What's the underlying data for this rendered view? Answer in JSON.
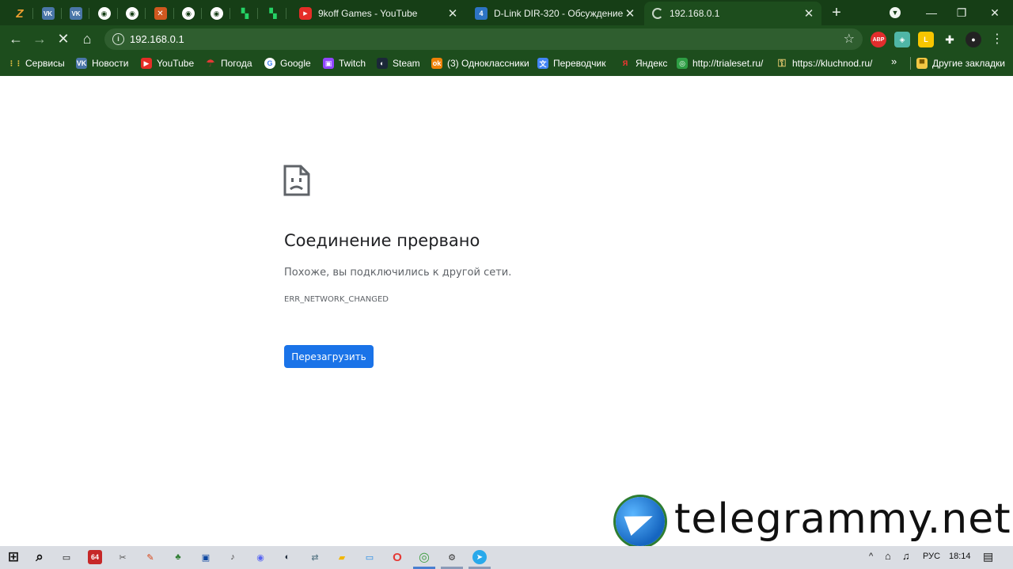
{
  "tabs": {
    "pinned": [
      {
        "icon": "z-icon",
        "glyph": "Z",
        "kind": "zz"
      },
      {
        "icon": "vk-icon",
        "glyph": "VK",
        "kind": "vk"
      },
      {
        "icon": "vk-icon",
        "glyph": "VK",
        "kind": "vk"
      },
      {
        "icon": "globe-icon",
        "glyph": "◉",
        "kind": "globe"
      },
      {
        "icon": "globe-icon",
        "glyph": "◉",
        "kind": "globe"
      },
      {
        "icon": "dota-icon",
        "glyph": "✕",
        "kind": "dota"
      },
      {
        "icon": "globe-icon",
        "glyph": "◉",
        "kind": "globe"
      },
      {
        "icon": "globe-icon",
        "glyph": "◉",
        "kind": "globe"
      },
      {
        "icon": "grid-icon",
        "glyph": "▚",
        "kind": "grid"
      },
      {
        "icon": "grid-icon",
        "glyph": "▚",
        "kind": "grid"
      }
    ],
    "items": [
      {
        "title": "9koff Games - YouTube",
        "icon": "youtube-icon"
      },
      {
        "title": "D-Link DIR-320 - Обсуждение -",
        "icon": "dlink-icon"
      },
      {
        "title": "192.168.0.1",
        "icon": "loading-spinner-icon"
      }
    ],
    "new_tab": "+"
  },
  "omnibox": {
    "url": "192.168.0.1"
  },
  "extensions": [
    {
      "name": "adblock-icon",
      "glyph": "ABP",
      "color": "#e22d2d"
    },
    {
      "name": "map-extension-icon",
      "glyph": "◈",
      "color": "#4fb6a6"
    },
    {
      "name": "tampermonkey-icon",
      "glyph": "L",
      "color": "#f7c600"
    },
    {
      "name": "puzzle-icon",
      "glyph": "✚",
      "color": "#1d4d1d"
    },
    {
      "name": "profile-avatar-icon",
      "glyph": "●",
      "color": "#222222"
    }
  ],
  "bookmarks": [
    {
      "label": "Сервисы",
      "icon": "apps-grid-icon",
      "glyph": "⋮⋮",
      "color": "#1d4d1d"
    },
    {
      "label": "Новости",
      "icon": "vk-icon",
      "glyph": "VK",
      "color": "#4a76a8"
    },
    {
      "label": "YouTube",
      "icon": "youtube-icon",
      "glyph": "▶",
      "color": "#e52d27"
    },
    {
      "label": "Погода",
      "icon": "umbrella-icon",
      "glyph": "☂",
      "color": "#1d4d1d"
    },
    {
      "label": "Google",
      "icon": "google-icon",
      "glyph": "G",
      "color": "#ffffff"
    },
    {
      "label": "Twitch",
      "icon": "twitch-icon",
      "glyph": "▣",
      "color": "#9146ff"
    },
    {
      "label": "Steam",
      "icon": "steam-icon",
      "glyph": "◐",
      "color": "#1b2838"
    },
    {
      "label": "(3) Одноклассники",
      "icon": "ok-icon",
      "glyph": "ok",
      "color": "#ee8208"
    },
    {
      "label": "Переводчик",
      "icon": "translate-icon",
      "glyph": "文",
      "color": "#4285f4"
    },
    {
      "label": "Яндекс",
      "icon": "yandex-icon",
      "glyph": "Я",
      "color": "#1d4d1d"
    },
    {
      "label": "http://trialeset.ru/",
      "icon": "globe-green-icon",
      "glyph": "◎",
      "color": "#2e9e44"
    },
    {
      "label": "https://kluchnod.ru/",
      "icon": "key-icon",
      "glyph": "⚿",
      "color": "#1d4d1d"
    }
  ],
  "bookmarks_more": "»",
  "other_bookmarks": "Другие закладки",
  "error": {
    "title": "Соединение прервано",
    "description": "Похоже, вы подключились к другой сети.",
    "code": "ERR_NETWORK_CHANGED",
    "reload_button": "Перезагрузить"
  },
  "watermark": {
    "text": "telegrammy.net"
  },
  "taskbar": {
    "apps": [
      {
        "name": "start-windows-icon",
        "glyph": "⊞",
        "color": "#111111"
      },
      {
        "name": "search-icon",
        "glyph": "⌕",
        "color": "#111111"
      },
      {
        "name": "task-view-icon",
        "glyph": "▭",
        "color": "#111111"
      },
      {
        "name": "aida64-icon",
        "glyph": "64",
        "color": "#c62828"
      },
      {
        "name": "snipping-tool-icon",
        "glyph": "✂",
        "color": "#555555"
      },
      {
        "name": "paint-icon",
        "glyph": "✎",
        "color": "#d84315"
      },
      {
        "name": "app-icon",
        "glyph": "♣",
        "color": "#2e7d32"
      },
      {
        "name": "terminal-icon",
        "glyph": "▣",
        "color": "#0d47a1"
      },
      {
        "name": "volume-mixer-icon",
        "glyph": "♪",
        "color": "#444444"
      },
      {
        "name": "discord-icon",
        "glyph": "◉",
        "color": "#5865f2"
      },
      {
        "name": "steam-icon",
        "glyph": "◐",
        "color": "#1b2838"
      },
      {
        "name": "network-tool-icon",
        "glyph": "⇄",
        "color": "#607d8b"
      },
      {
        "name": "file-explorer-icon",
        "glyph": "▰",
        "color": "#f2b705"
      },
      {
        "name": "monitor-icon",
        "glyph": "▭",
        "color": "#1e88e5"
      },
      {
        "name": "opera-icon",
        "glyph": "O",
        "color": "#e53935"
      },
      {
        "name": "chrome-icon",
        "glyph": "◎",
        "color": "#43a047"
      },
      {
        "name": "settings-gear-icon",
        "glyph": "⚙",
        "color": "#333333"
      },
      {
        "name": "telegram-icon",
        "glyph": "➤",
        "color": "#29a9eb"
      }
    ],
    "tray": {
      "chevron": "^",
      "network": "⌂",
      "volume": "♫",
      "language": "РУС",
      "time": "18:14",
      "notifications": "▤"
    }
  }
}
